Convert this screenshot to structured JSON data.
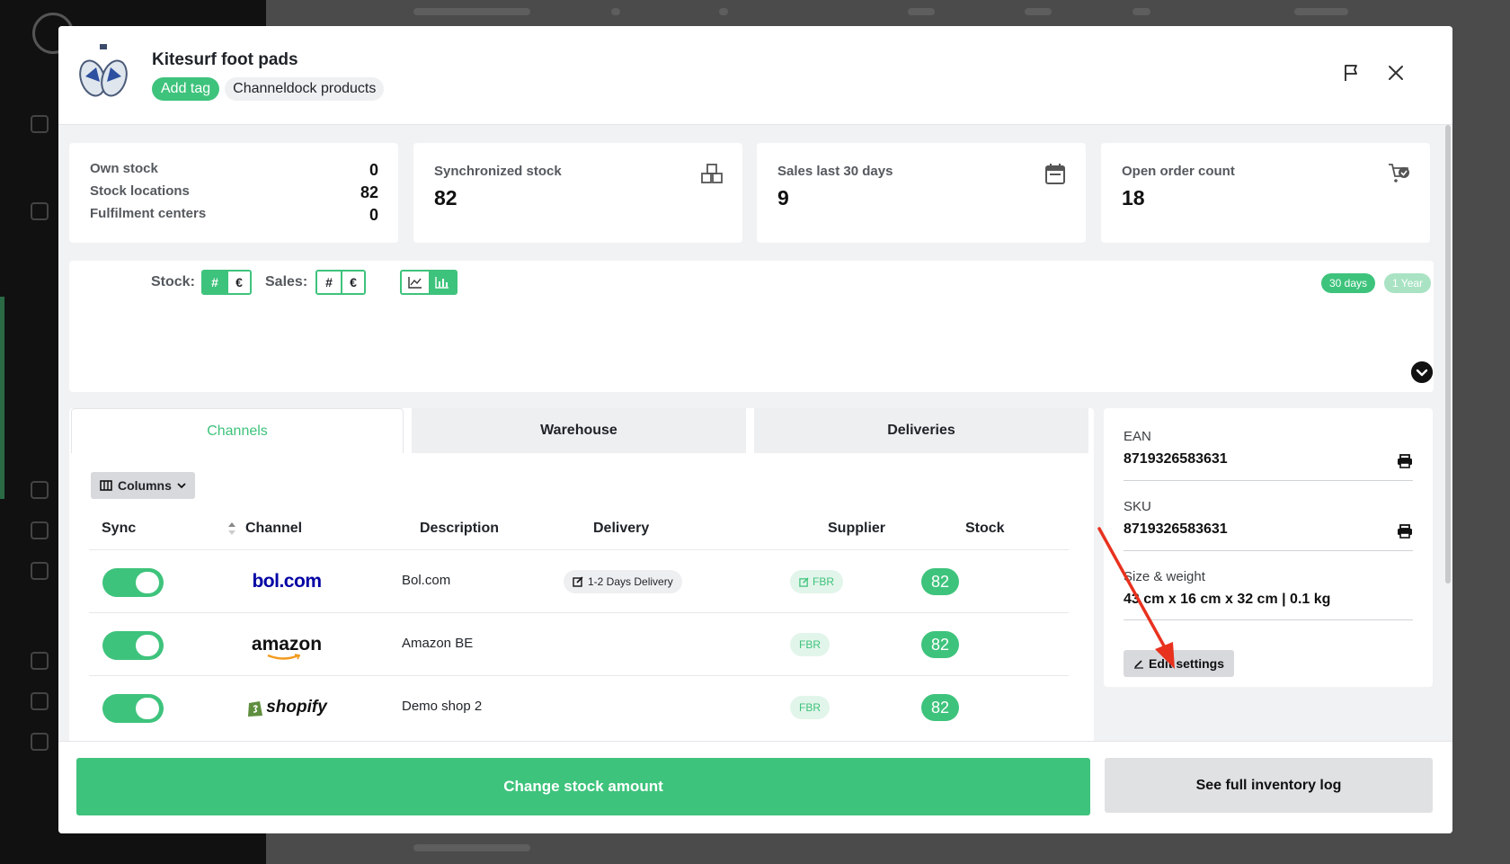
{
  "product": {
    "title": "Kitesurf foot pads",
    "tags": {
      "add_label": "Add tag",
      "items": [
        "Channeldock products"
      ]
    }
  },
  "header_icons": [
    "flag-icon",
    "close-icon"
  ],
  "stock_summary": {
    "rows": [
      {
        "label": "Own stock",
        "value": "0"
      },
      {
        "label": "Stock locations",
        "value": "82"
      },
      {
        "label": "Fulfilment centers",
        "value": "0"
      }
    ]
  },
  "stats": [
    {
      "label": "Synchronized stock",
      "value": "82",
      "icon": "boxes-icon"
    },
    {
      "label": "Sales last 30 days",
      "value": "9",
      "icon": "calendar-icon"
    },
    {
      "label": "Open order count",
      "value": "18",
      "icon": "cart-check-icon"
    }
  ],
  "chart_controls": {
    "stock_label": "Stock:",
    "sales_label": "Sales:",
    "count_symbol": "#",
    "euro_symbol": "€",
    "view_icons": [
      "line-chart-icon",
      "bar-chart-icon"
    ],
    "range_30": "30 days",
    "range_year": "1 Year"
  },
  "tabs": {
    "channels": "Channels",
    "warehouse": "Warehouse",
    "deliveries": "Deliveries"
  },
  "columns_button": "Columns",
  "table": {
    "headers": {
      "sync": "Sync",
      "channel": "Channel",
      "description": "Description",
      "delivery": "Delivery",
      "supplier": "Supplier",
      "stock": "Stock"
    },
    "rows": [
      {
        "channel_logo": "bol.com",
        "description": "Bol.com",
        "delivery": "1-2 Days Delivery",
        "supplier": "FBR",
        "stock": "82"
      },
      {
        "channel_logo": "amazon",
        "description": "Amazon BE",
        "delivery": "",
        "supplier": "FBR",
        "stock": "82"
      },
      {
        "channel_logo": "shopify",
        "description": "Demo shop 2",
        "delivery": "",
        "supplier": "FBR",
        "stock": "82"
      }
    ]
  },
  "info": {
    "ean_label": "EAN",
    "ean": "8719326583631",
    "sku_label": "SKU",
    "sku": "8719326583631",
    "size_label": "Size & weight",
    "size": "43 cm x 16 cm x 32 cm | 0.1 kg",
    "edit_label": "Edit settings"
  },
  "footer": {
    "change_label": "Change stock amount",
    "log_label": "See full inventory log"
  },
  "colors": {
    "accent": "#3ec37c",
    "annotation_arrow": "#e8321e"
  }
}
